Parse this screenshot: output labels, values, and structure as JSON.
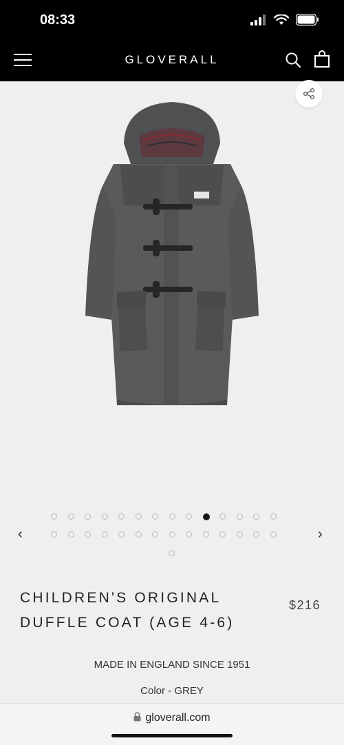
{
  "status_bar": {
    "time": "08:33"
  },
  "header": {
    "brand": "GLOVERALL"
  },
  "pager": {
    "total_dots": 29,
    "active_index": 9,
    "prev_icon": "chevron-left-icon",
    "next_icon": "chevron-right-icon"
  },
  "product": {
    "title_line1": "CHILDREN'S ORIGINAL",
    "title_line2": "DUFFLE COAT (AGE 4-6)",
    "price": "$216",
    "tagline": "MADE IN ENGLAND SINCE 1951",
    "color": "Color - GREY"
  },
  "browser": {
    "url": "gloverall.com"
  },
  "colors": {
    "header_bg": "#000000",
    "page_bg": "#efefef",
    "coat_grey": "#5a5a5c",
    "active_dot": "#1a1a1a"
  }
}
